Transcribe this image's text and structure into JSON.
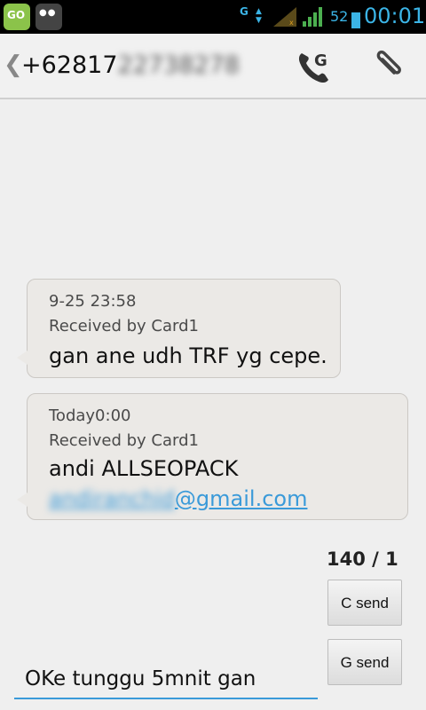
{
  "status_bar": {
    "network_label": "G",
    "battery_percent": "52",
    "time": "00:01",
    "accent_color": "#3bb4e6",
    "icons": [
      "go-sms-icon",
      "bbm-icon",
      "network-g-icon",
      "signal-roaming-icon",
      "signal-strength-icon",
      "battery-icon"
    ]
  },
  "action_bar": {
    "back_glyph": "❮",
    "contact_prefix": "+62817",
    "contact_blurred": "22738278"
  },
  "messages": [
    {
      "date": "9-25 23:58",
      "received_by": "Received by Card1",
      "body": "gan ane udh TRF yg cepe."
    },
    {
      "date": "Today0:00",
      "received_by": "Received by Card1",
      "body": "andi ALLSEOPACK",
      "link_blurred": "andiranchid",
      "link_domain": "@gmail.com"
    }
  ],
  "compose": {
    "counter": "140 / 1",
    "c_send_label": "C send",
    "g_send_label": "G send",
    "input_value": "OKe tunggu 5mnit gan"
  }
}
